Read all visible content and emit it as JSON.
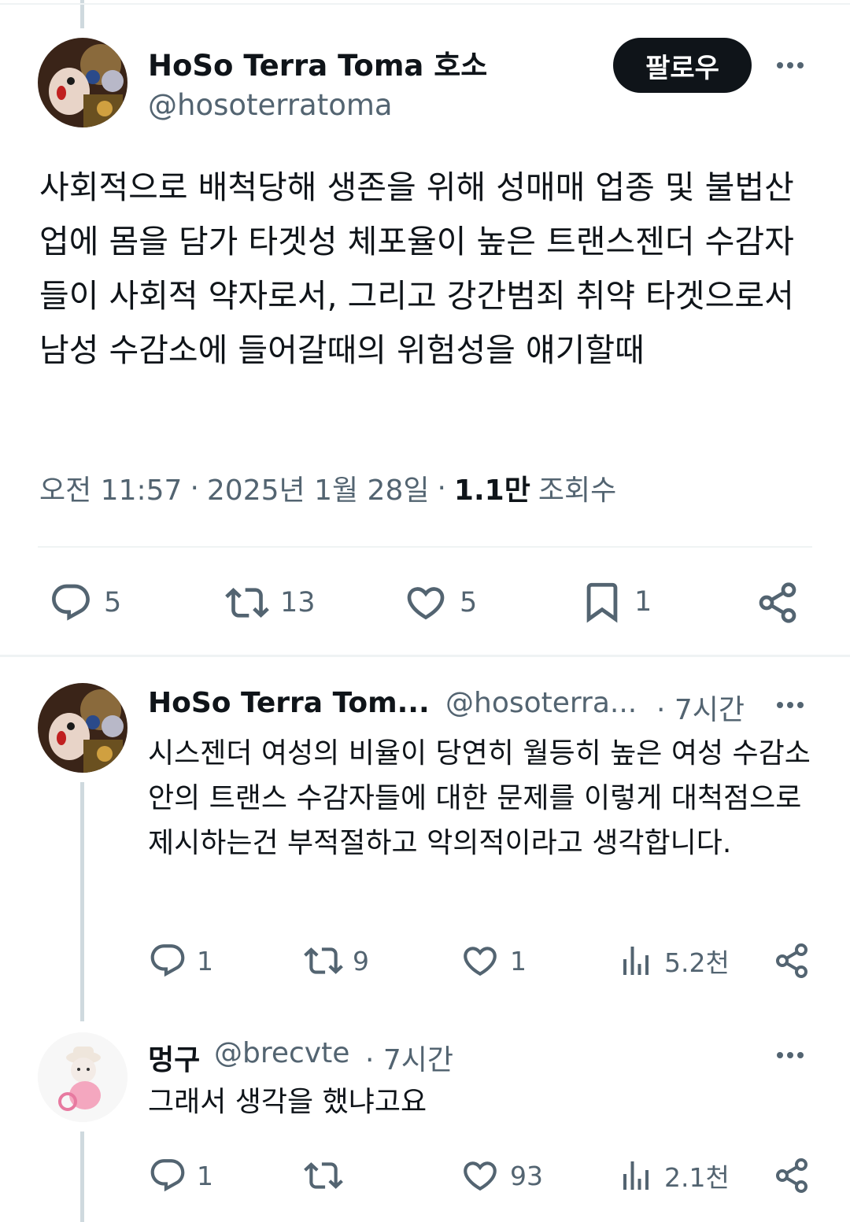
{
  "main_tweet": {
    "author_name": "HoSo Terra Toma 호소",
    "handle": "@hosoterratoma",
    "follow_label": "팔로우",
    "text": "사회적으로 배척당해 생존을 위해 성매매 업종 및 불법산업에 몸을 담가 타겟성 체포율이 높은 트랜스젠더 수감자들이 사회적 약자로서, 그리고 강간범죄 취약 타겟으로서 남성 수감소에 들어갈때의 위험성을 얘기할때",
    "time": "오전 11:57",
    "date": "2025년 1월 28일",
    "views_count": "1.1만",
    "views_label": "조회수",
    "actions": {
      "replies": "5",
      "retweets": "13",
      "likes": "5",
      "bookmarks": "1"
    }
  },
  "reply1": {
    "author_name": "HoSo Terra Tom...",
    "handle": "@hosoterra...",
    "time": "· 7시간",
    "text": "시스젠더 여성의 비율이 당연히 월등히 높은 여성 수감소안의 트랜스 수감자들에 대한 문제를 이렇게 대척점으로 제시하는건 부적절하고 악의적이라고 생각합니다.",
    "actions": {
      "replies": "1",
      "retweets": "9",
      "likes": "1",
      "views": "5.2천"
    }
  },
  "reply2": {
    "author_name": "멍구",
    "handle": "@brecvte",
    "time": "· 7시간",
    "text": "그래서 생각을 했냐고요",
    "actions": {
      "replies": "1",
      "retweets": "",
      "likes": "93",
      "views": "2.1천"
    }
  },
  "colors": {
    "text": "#0f1419",
    "secondary": "#536471",
    "divider": "#eff3f4",
    "thread_line": "#cfd9de",
    "button": "#0f1419"
  },
  "icons": [
    "reply-icon",
    "retweet-icon",
    "like-icon",
    "bookmark-icon",
    "share-icon",
    "views-icon",
    "more-icon"
  ]
}
